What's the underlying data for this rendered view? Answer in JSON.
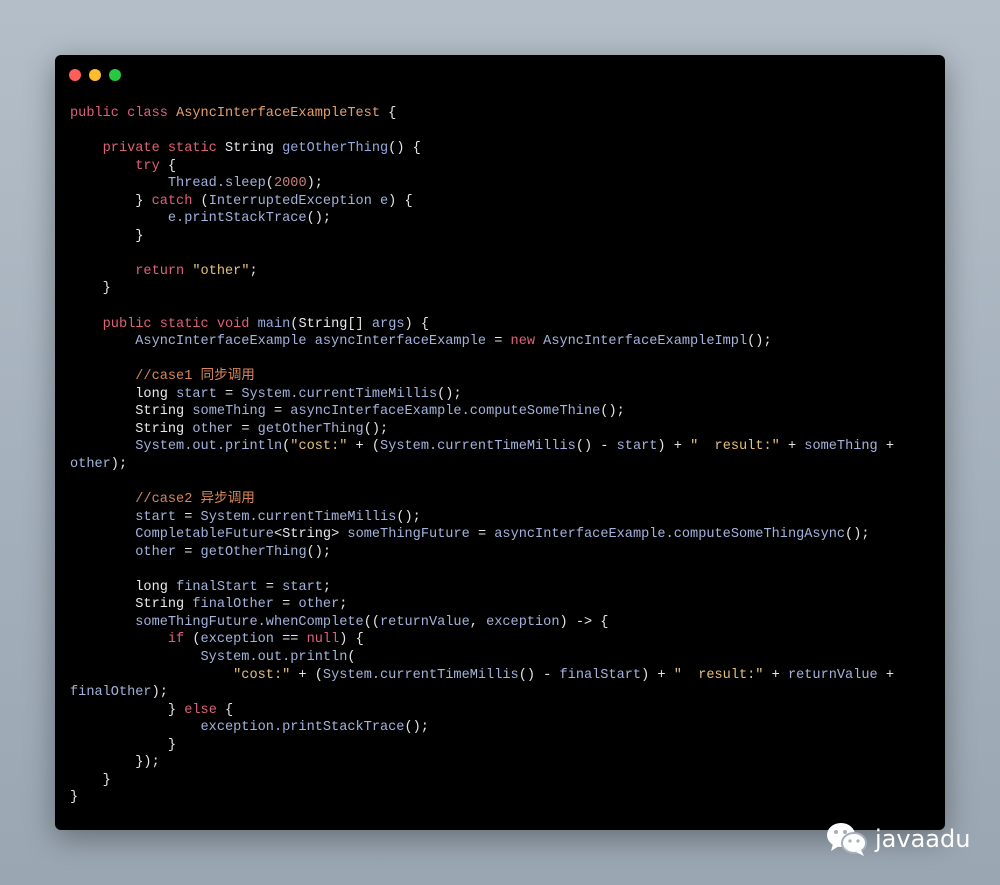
{
  "window": {
    "controls": [
      "close",
      "minimize",
      "maximize"
    ]
  },
  "colors": {
    "keyword": "#e0607a",
    "class_name": "#e8a06a",
    "function": "#93a9dc",
    "type": "#e8e8ee",
    "identifier": "#a3b3dc",
    "string": "#e5c07b",
    "number": "#c97f7f",
    "comment": "#d9875a",
    "background": "#000000"
  },
  "code_lines": [
    [
      [
        "k",
        "public class "
      ],
      [
        "c",
        "AsyncInterfaceExampleTest"
      ],
      [
        "p",
        " {"
      ]
    ],
    [],
    [
      [
        "k",
        "    private static "
      ],
      [
        "t",
        "String "
      ],
      [
        "f",
        "getOtherThing"
      ],
      [
        "p",
        "() {"
      ]
    ],
    [
      [
        "k",
        "        try "
      ],
      [
        "p",
        "{"
      ]
    ],
    [
      [
        "v",
        "            Thread.sleep"
      ],
      [
        "p",
        "("
      ],
      [
        "n",
        "2000"
      ],
      [
        "p",
        ");"
      ]
    ],
    [
      [
        "p",
        "        } "
      ],
      [
        "k",
        "catch "
      ],
      [
        "p",
        "("
      ],
      [
        "v",
        "InterruptedException e"
      ],
      [
        "p",
        ") {"
      ]
    ],
    [
      [
        "v",
        "            e.printStackTrace"
      ],
      [
        "p",
        "();"
      ]
    ],
    [
      [
        "p",
        "        }"
      ]
    ],
    [],
    [
      [
        "k",
        "        return "
      ],
      [
        "s",
        "\"other\""
      ],
      [
        "p",
        ";"
      ]
    ],
    [
      [
        "p",
        "    }"
      ]
    ],
    [],
    [
      [
        "k",
        "    public static void "
      ],
      [
        "f",
        "main"
      ],
      [
        "p",
        "("
      ],
      [
        "t",
        "String"
      ],
      [
        "p",
        "[] "
      ],
      [
        "v",
        "args"
      ],
      [
        "p",
        ") {"
      ]
    ],
    [
      [
        "v",
        "        AsyncInterfaceExample asyncInterfaceExample "
      ],
      [
        "p",
        "= "
      ],
      [
        "k",
        "new "
      ],
      [
        "v",
        "AsyncInterfaceExampleImpl"
      ],
      [
        "p",
        "();"
      ]
    ],
    [],
    [
      [
        "m",
        "        //case1 同步调用"
      ]
    ],
    [
      [
        "t",
        "        long "
      ],
      [
        "v",
        "start "
      ],
      [
        "p",
        "= "
      ],
      [
        "v",
        "System.currentTimeMillis"
      ],
      [
        "p",
        "();"
      ]
    ],
    [
      [
        "t",
        "        String "
      ],
      [
        "v",
        "someThing "
      ],
      [
        "p",
        "= "
      ],
      [
        "v",
        "asyncInterfaceExample.computeSomeThine"
      ],
      [
        "p",
        "();"
      ]
    ],
    [
      [
        "t",
        "        String "
      ],
      [
        "v",
        "other "
      ],
      [
        "p",
        "= "
      ],
      [
        "v",
        "getOtherThing"
      ],
      [
        "p",
        "();"
      ]
    ],
    [
      [
        "v",
        "        System.out.println"
      ],
      [
        "p",
        "("
      ],
      [
        "s",
        "\"cost:\""
      ],
      [
        "p",
        " + ("
      ],
      [
        "v",
        "System.currentTimeMillis"
      ],
      [
        "p",
        "() - "
      ],
      [
        "v",
        "start"
      ],
      [
        "p",
        ") + "
      ],
      [
        "s",
        "\"  result:\""
      ],
      [
        "p",
        " + "
      ],
      [
        "v",
        "someThing"
      ],
      [
        "p",
        " +"
      ]
    ],
    [
      [
        "v",
        "other"
      ],
      [
        "p",
        ");"
      ]
    ],
    [],
    [
      [
        "m",
        "        //case2 异步调用"
      ]
    ],
    [
      [
        "v",
        "        start "
      ],
      [
        "p",
        "= "
      ],
      [
        "v",
        "System.currentTimeMillis"
      ],
      [
        "p",
        "();"
      ]
    ],
    [
      [
        "v",
        "        CompletableFuture"
      ],
      [
        "p",
        "<"
      ],
      [
        "t",
        "String"
      ],
      [
        "p",
        "> "
      ],
      [
        "v",
        "someThingFuture "
      ],
      [
        "p",
        "= "
      ],
      [
        "v",
        "asyncInterfaceExample.computeSomeThingAsync"
      ],
      [
        "p",
        "();"
      ]
    ],
    [
      [
        "v",
        "        other "
      ],
      [
        "p",
        "= "
      ],
      [
        "v",
        "getOtherThing"
      ],
      [
        "p",
        "();"
      ]
    ],
    [],
    [
      [
        "t",
        "        long "
      ],
      [
        "v",
        "finalStart "
      ],
      [
        "p",
        "= "
      ],
      [
        "v",
        "start"
      ],
      [
        "p",
        ";"
      ]
    ],
    [
      [
        "t",
        "        String "
      ],
      [
        "v",
        "finalOther "
      ],
      [
        "p",
        "= "
      ],
      [
        "v",
        "other"
      ],
      [
        "p",
        ";"
      ]
    ],
    [
      [
        "v",
        "        someThingFuture.whenComplete"
      ],
      [
        "p",
        "(("
      ],
      [
        "v",
        "returnValue"
      ],
      [
        "p",
        ", "
      ],
      [
        "v",
        "exception"
      ],
      [
        "p",
        ") -> {"
      ]
    ],
    [
      [
        "k",
        "            if "
      ],
      [
        "p",
        "("
      ],
      [
        "v",
        "exception "
      ],
      [
        "p",
        "== "
      ],
      [
        "k",
        "null"
      ],
      [
        "p",
        ") {"
      ]
    ],
    [
      [
        "v",
        "                System.out.println"
      ],
      [
        "p",
        "("
      ]
    ],
    [
      [
        "s",
        "                    \"cost:\""
      ],
      [
        "p",
        " + ("
      ],
      [
        "v",
        "System.currentTimeMillis"
      ],
      [
        "p",
        "() - "
      ],
      [
        "v",
        "finalStart"
      ],
      [
        "p",
        ") + "
      ],
      [
        "s",
        "\"  result:\""
      ],
      [
        "p",
        " + "
      ],
      [
        "v",
        "returnValue"
      ],
      [
        "p",
        " +"
      ]
    ],
    [
      [
        "v",
        "finalOther"
      ],
      [
        "p",
        ");"
      ]
    ],
    [
      [
        "p",
        "            } "
      ],
      [
        "k",
        "else "
      ],
      [
        "p",
        "{"
      ]
    ],
    [
      [
        "v",
        "                exception.printStackTrace"
      ],
      [
        "p",
        "();"
      ]
    ],
    [
      [
        "p",
        "            }"
      ]
    ],
    [
      [
        "p",
        "        });"
      ]
    ],
    [
      [
        "p",
        "    }"
      ]
    ],
    [
      [
        "p",
        "}"
      ]
    ]
  ],
  "watermark": {
    "text": "javaadu",
    "icon": "wechat-icon"
  }
}
